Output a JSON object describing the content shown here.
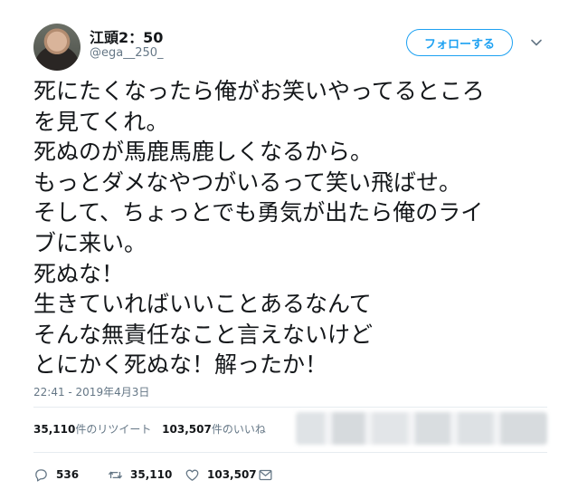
{
  "user": {
    "name": "江頭2：50",
    "handle": "@ega__250_"
  },
  "follow_label": "フォローする",
  "tweet_lines": [
    "死にたくなったら俺がお笑いやってるところ",
    "を見てくれ。",
    "死ぬのが馬鹿馬鹿しくなるから。",
    "もっとダメなやつがいるって笑い飛ばせ。",
    "そして、ちょっとでも勇気が出たら俺のライ",
    "ブに来い。",
    "死ぬな！",
    "生きていればいいことあるなんて",
    "そんな無責任なこと言えないけど",
    "とにかく死ぬな！解ったか！"
  ],
  "timestamp": "22:41 - 2019年4月3日",
  "stats": {
    "retweets_count": "35,110",
    "retweets_label": "件のリツイート",
    "likes_count": "103,507",
    "likes_label": "件のいいね"
  },
  "actions": {
    "reply_count": "536",
    "retweet_count": "35,110",
    "like_count": "103,507"
  },
  "icons": [
    "chevron-down-icon",
    "reply-icon",
    "retweet-icon",
    "heart-icon",
    "mail-icon"
  ],
  "colors": {
    "accent": "#1da1f2",
    "text": "#14171a",
    "muted": "#657786"
  }
}
